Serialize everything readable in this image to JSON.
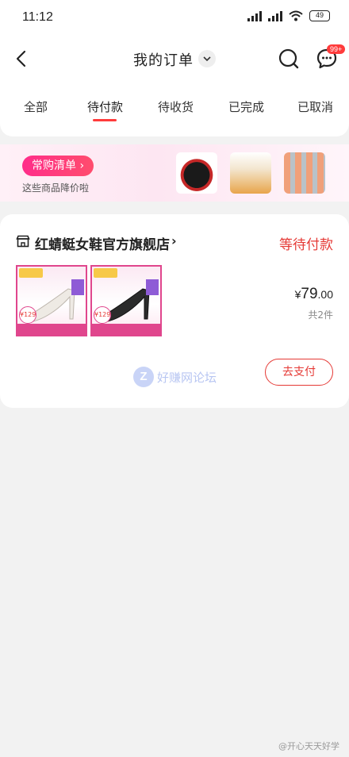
{
  "status_bar": {
    "time": "11:12",
    "battery": "49"
  },
  "header": {
    "title": "我的订单",
    "badge": "99+"
  },
  "tabs": [
    {
      "label": "全部"
    },
    {
      "label": "待付款"
    },
    {
      "label": "待收货"
    },
    {
      "label": "已完成"
    },
    {
      "label": "已取消"
    }
  ],
  "banner": {
    "pill_label": "常购清单",
    "pill_arrow": "›",
    "subtitle": "这些商品降价啦"
  },
  "order": {
    "store_name": "红蜻蜓女鞋官方旗舰店",
    "store_arrow": "›",
    "status": "等待付款",
    "price_symbol": "¥",
    "price_int": "79",
    "price_dec": ".00",
    "item_count": "共2件",
    "thumb_price_1": "¥129",
    "thumb_price_2": "¥129",
    "pay_button": "去支付"
  },
  "watermark": {
    "z": "Z",
    "text": "好赚网论坛"
  },
  "credit": "@开心天天好学",
  "colors": {
    "accent_red": "#e53935",
    "pink": "#ff2d8a"
  }
}
